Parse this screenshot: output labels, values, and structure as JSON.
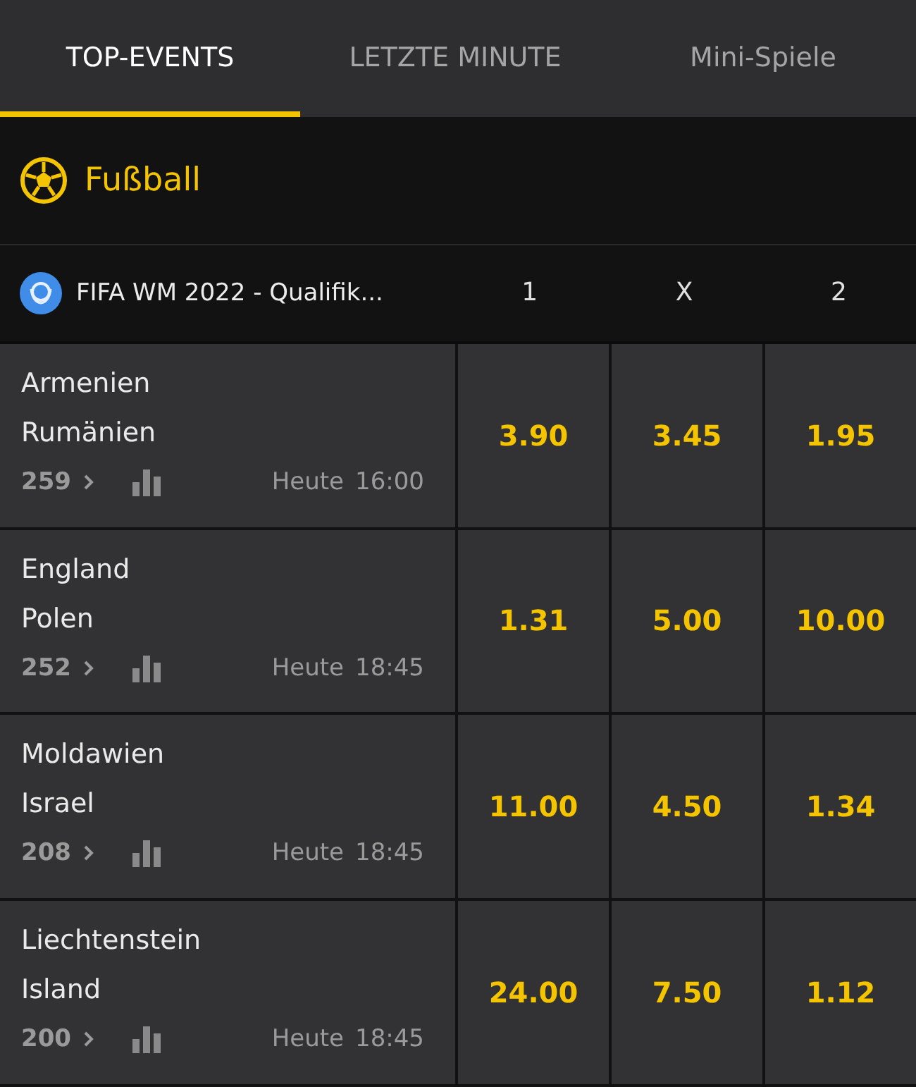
{
  "tabs": [
    {
      "label": "TOP-EVENTS",
      "selected": true
    },
    {
      "label": "LETZTE MINUTE",
      "selected": false
    },
    {
      "label": "Mini-Spiele",
      "selected": false
    }
  ],
  "sport": {
    "title": "Fußball"
  },
  "league": {
    "name": "FIFA WM 2022 - Qualifik...",
    "columns": [
      "1",
      "X",
      "2"
    ]
  },
  "matches": [
    {
      "home": "Armenien",
      "away": "Rumänien",
      "count": "259",
      "day": "Heute",
      "time": "16:00",
      "odds": [
        "3.90",
        "3.45",
        "1.95"
      ]
    },
    {
      "home": "England",
      "away": "Polen",
      "count": "252",
      "day": "Heute",
      "time": "18:45",
      "odds": [
        "1.31",
        "5.00",
        "10.00"
      ]
    },
    {
      "home": "Moldawien",
      "away": "Israel",
      "count": "208",
      "day": "Heute",
      "time": "18:45",
      "odds": [
        "11.00",
        "4.50",
        "1.34"
      ]
    },
    {
      "home": "Liechtenstein",
      "away": "Island",
      "count": "200",
      "day": "Heute",
      "time": "18:45",
      "odds": [
        "24.00",
        "7.50",
        "1.12"
      ]
    }
  ]
}
